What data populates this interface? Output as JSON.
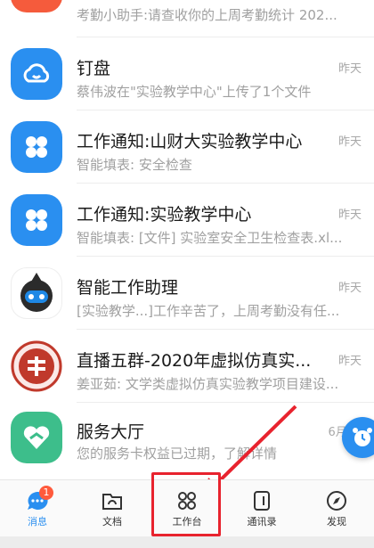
{
  "conversations": [
    {
      "title": "",
      "time": "",
      "subtitle": "考勤小助手:请查收你的上周考勤统计 202...",
      "icon": "attendance-icon",
      "color": "#f55b3c"
    },
    {
      "title": "钉盘",
      "time": "昨天",
      "subtitle": "蔡伟波在\"实验教学中心\"上传了1个文件",
      "icon": "cloud-disk-icon",
      "color": "#2a8ff0"
    },
    {
      "title": "工作通知:山财大实验教学中心",
      "time": "昨天",
      "subtitle": "智能填表: 安全检查",
      "icon": "work-notice-icon",
      "color": "#2a8ff0"
    },
    {
      "title": "工作通知:实验教学中心",
      "time": "昨天",
      "subtitle": "智能填表: [文件] 实验室安全卫生检查表.xl...",
      "icon": "work-notice-icon",
      "color": "#2a8ff0"
    },
    {
      "title": "智能工作助理",
      "time": "昨天",
      "subtitle": "[实验教学...]工作辛苦了，上周考勤没有任...",
      "icon": "robot-assistant-icon",
      "color": "#ffffff"
    },
    {
      "title": "直播五群-2020年虚拟仿真实...",
      "time": "昨天",
      "subtitle": "姜亚茹: 文学类虚拟仿真实验教学项目建设...",
      "icon": "university-logo-icon",
      "color": "#c0392b"
    },
    {
      "title": "服务大厅",
      "time": "6月2",
      "subtitle": "您的服务卡权益已过期，了解详情",
      "icon": "heart-hand-icon",
      "color": "#3dbe8b"
    }
  ],
  "tabbar": {
    "tabs": [
      {
        "label": "消息",
        "icon": "message-icon",
        "active": true,
        "badge": "1"
      },
      {
        "label": "文档",
        "icon": "document-icon",
        "active": false
      },
      {
        "label": "工作台",
        "icon": "workbench-icon",
        "active": false
      },
      {
        "label": "通讯录",
        "icon": "contacts-icon",
        "active": false
      },
      {
        "label": "发现",
        "icon": "compass-icon",
        "active": false
      }
    ]
  },
  "colors": {
    "accent": "#2a8ff0",
    "annotation": "#e8232e"
  }
}
